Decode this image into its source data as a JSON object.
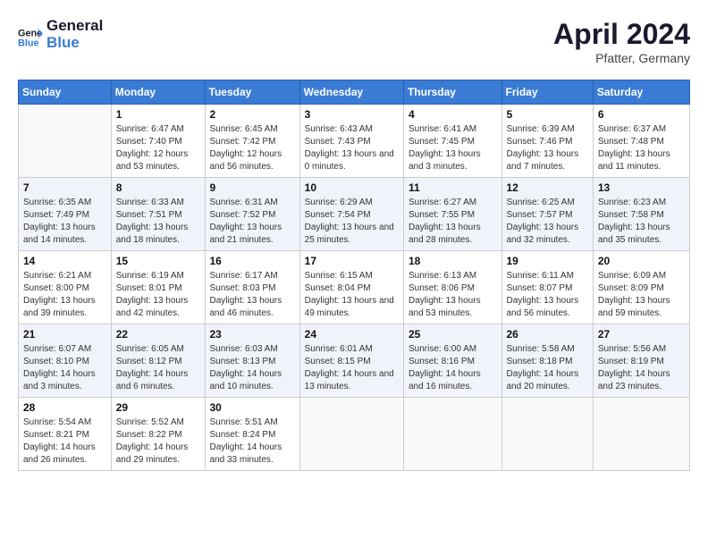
{
  "header": {
    "logo_line1": "General",
    "logo_line2": "Blue",
    "month_title": "April 2024",
    "location": "Pfatter, Germany"
  },
  "days_of_week": [
    "Sunday",
    "Monday",
    "Tuesday",
    "Wednesday",
    "Thursday",
    "Friday",
    "Saturday"
  ],
  "weeks": [
    [
      {
        "num": "",
        "sunrise": "",
        "sunset": "",
        "daylight": ""
      },
      {
        "num": "1",
        "sunrise": "Sunrise: 6:47 AM",
        "sunset": "Sunset: 7:40 PM",
        "daylight": "Daylight: 12 hours and 53 minutes."
      },
      {
        "num": "2",
        "sunrise": "Sunrise: 6:45 AM",
        "sunset": "Sunset: 7:42 PM",
        "daylight": "Daylight: 12 hours and 56 minutes."
      },
      {
        "num": "3",
        "sunrise": "Sunrise: 6:43 AM",
        "sunset": "Sunset: 7:43 PM",
        "daylight": "Daylight: 13 hours and 0 minutes."
      },
      {
        "num": "4",
        "sunrise": "Sunrise: 6:41 AM",
        "sunset": "Sunset: 7:45 PM",
        "daylight": "Daylight: 13 hours and 3 minutes."
      },
      {
        "num": "5",
        "sunrise": "Sunrise: 6:39 AM",
        "sunset": "Sunset: 7:46 PM",
        "daylight": "Daylight: 13 hours and 7 minutes."
      },
      {
        "num": "6",
        "sunrise": "Sunrise: 6:37 AM",
        "sunset": "Sunset: 7:48 PM",
        "daylight": "Daylight: 13 hours and 11 minutes."
      }
    ],
    [
      {
        "num": "7",
        "sunrise": "Sunrise: 6:35 AM",
        "sunset": "Sunset: 7:49 PM",
        "daylight": "Daylight: 13 hours and 14 minutes."
      },
      {
        "num": "8",
        "sunrise": "Sunrise: 6:33 AM",
        "sunset": "Sunset: 7:51 PM",
        "daylight": "Daylight: 13 hours and 18 minutes."
      },
      {
        "num": "9",
        "sunrise": "Sunrise: 6:31 AM",
        "sunset": "Sunset: 7:52 PM",
        "daylight": "Daylight: 13 hours and 21 minutes."
      },
      {
        "num": "10",
        "sunrise": "Sunrise: 6:29 AM",
        "sunset": "Sunset: 7:54 PM",
        "daylight": "Daylight: 13 hours and 25 minutes."
      },
      {
        "num": "11",
        "sunrise": "Sunrise: 6:27 AM",
        "sunset": "Sunset: 7:55 PM",
        "daylight": "Daylight: 13 hours and 28 minutes."
      },
      {
        "num": "12",
        "sunrise": "Sunrise: 6:25 AM",
        "sunset": "Sunset: 7:57 PM",
        "daylight": "Daylight: 13 hours and 32 minutes."
      },
      {
        "num": "13",
        "sunrise": "Sunrise: 6:23 AM",
        "sunset": "Sunset: 7:58 PM",
        "daylight": "Daylight: 13 hours and 35 minutes."
      }
    ],
    [
      {
        "num": "14",
        "sunrise": "Sunrise: 6:21 AM",
        "sunset": "Sunset: 8:00 PM",
        "daylight": "Daylight: 13 hours and 39 minutes."
      },
      {
        "num": "15",
        "sunrise": "Sunrise: 6:19 AM",
        "sunset": "Sunset: 8:01 PM",
        "daylight": "Daylight: 13 hours and 42 minutes."
      },
      {
        "num": "16",
        "sunrise": "Sunrise: 6:17 AM",
        "sunset": "Sunset: 8:03 PM",
        "daylight": "Daylight: 13 hours and 46 minutes."
      },
      {
        "num": "17",
        "sunrise": "Sunrise: 6:15 AM",
        "sunset": "Sunset: 8:04 PM",
        "daylight": "Daylight: 13 hours and 49 minutes."
      },
      {
        "num": "18",
        "sunrise": "Sunrise: 6:13 AM",
        "sunset": "Sunset: 8:06 PM",
        "daylight": "Daylight: 13 hours and 53 minutes."
      },
      {
        "num": "19",
        "sunrise": "Sunrise: 6:11 AM",
        "sunset": "Sunset: 8:07 PM",
        "daylight": "Daylight: 13 hours and 56 minutes."
      },
      {
        "num": "20",
        "sunrise": "Sunrise: 6:09 AM",
        "sunset": "Sunset: 8:09 PM",
        "daylight": "Daylight: 13 hours and 59 minutes."
      }
    ],
    [
      {
        "num": "21",
        "sunrise": "Sunrise: 6:07 AM",
        "sunset": "Sunset: 8:10 PM",
        "daylight": "Daylight: 14 hours and 3 minutes."
      },
      {
        "num": "22",
        "sunrise": "Sunrise: 6:05 AM",
        "sunset": "Sunset: 8:12 PM",
        "daylight": "Daylight: 14 hours and 6 minutes."
      },
      {
        "num": "23",
        "sunrise": "Sunrise: 6:03 AM",
        "sunset": "Sunset: 8:13 PM",
        "daylight": "Daylight: 14 hours and 10 minutes."
      },
      {
        "num": "24",
        "sunrise": "Sunrise: 6:01 AM",
        "sunset": "Sunset: 8:15 PM",
        "daylight": "Daylight: 14 hours and 13 minutes."
      },
      {
        "num": "25",
        "sunrise": "Sunrise: 6:00 AM",
        "sunset": "Sunset: 8:16 PM",
        "daylight": "Daylight: 14 hours and 16 minutes."
      },
      {
        "num": "26",
        "sunrise": "Sunrise: 5:58 AM",
        "sunset": "Sunset: 8:18 PM",
        "daylight": "Daylight: 14 hours and 20 minutes."
      },
      {
        "num": "27",
        "sunrise": "Sunrise: 5:56 AM",
        "sunset": "Sunset: 8:19 PM",
        "daylight": "Daylight: 14 hours and 23 minutes."
      }
    ],
    [
      {
        "num": "28",
        "sunrise": "Sunrise: 5:54 AM",
        "sunset": "Sunset: 8:21 PM",
        "daylight": "Daylight: 14 hours and 26 minutes."
      },
      {
        "num": "29",
        "sunrise": "Sunrise: 5:52 AM",
        "sunset": "Sunset: 8:22 PM",
        "daylight": "Daylight: 14 hours and 29 minutes."
      },
      {
        "num": "30",
        "sunrise": "Sunrise: 5:51 AM",
        "sunset": "Sunset: 8:24 PM",
        "daylight": "Daylight: 14 hours and 33 minutes."
      },
      {
        "num": "",
        "sunrise": "",
        "sunset": "",
        "daylight": ""
      },
      {
        "num": "",
        "sunrise": "",
        "sunset": "",
        "daylight": ""
      },
      {
        "num": "",
        "sunrise": "",
        "sunset": "",
        "daylight": ""
      },
      {
        "num": "",
        "sunrise": "",
        "sunset": "",
        "daylight": ""
      }
    ]
  ]
}
